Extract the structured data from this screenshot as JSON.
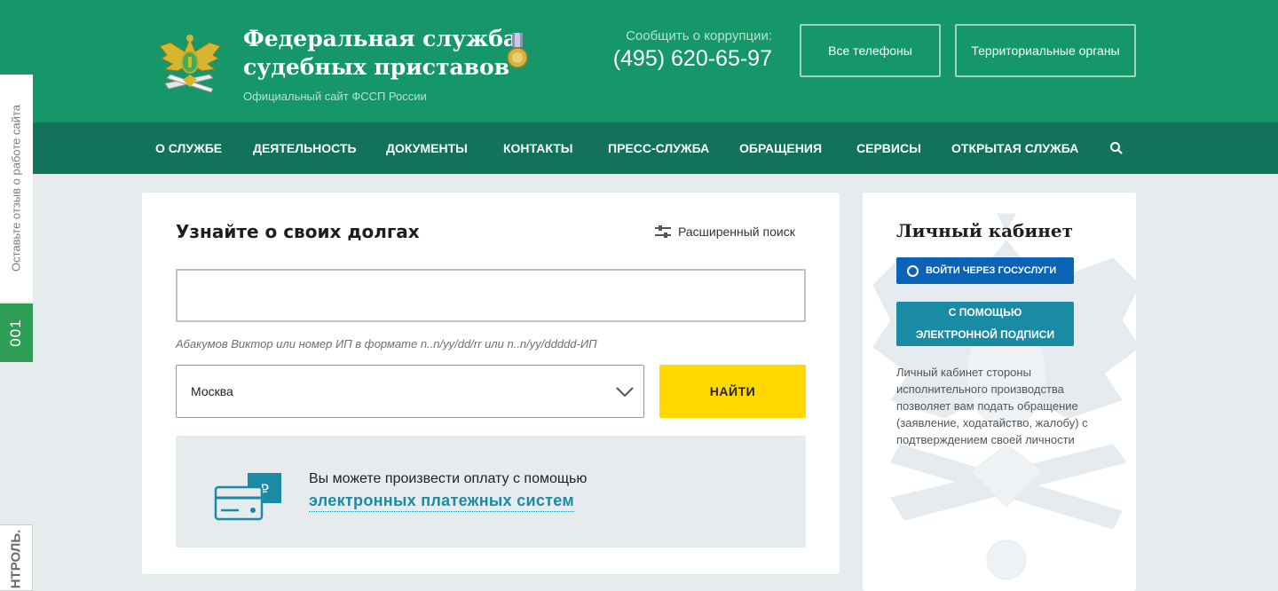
{
  "header": {
    "title_line1": "Федеральная служба",
    "title_line2": "судебных приставов",
    "subtitle": "Официальный сайт ФССП России",
    "corruption_label": "Сообщить о коррупции:",
    "phone": "(495) 620-65-97",
    "phones_button": "Все телефоны",
    "regions_button": "Территориальные органы",
    "logo_icon": "eagle-emblem-icon",
    "medal_icon": "medal-icon"
  },
  "nav": {
    "items": [
      "О СЛУЖБЕ",
      "ДЕЯТЕЛЬНОСТЬ",
      "ДОКУМЕНТЫ",
      "КОНТАКТЫ",
      "ПРЕСС-СЛУЖБА",
      "ОБРАЩЕНИЯ",
      "СЕРВИСЫ",
      "ОТКРЫТАЯ СЛУЖБА"
    ],
    "search_icon": "search-icon"
  },
  "side_tabs": {
    "feedback": "Оставьте отзыв о работе сайта",
    "badge": "001",
    "control": "НТРОЛЬ."
  },
  "debt_search": {
    "title": "Узнайте о своих долгах",
    "advanced_search": "Расширенный поиск",
    "input_value": "",
    "hint": "Абакумов Виктор или номер ИП в формате n..n/yy/dd/rr или n..n/yy/ddddd-ИП",
    "region_value": "Москва",
    "find_button": "НАЙТИ",
    "payment_text": "Вы можете произвести оплату с помощью",
    "payment_link": "электронных платежных систем",
    "payment_icon": "card-ruble-icon"
  },
  "cabinet": {
    "title": "Личный кабинет",
    "gosuslugi_button": "ВОЙТИ ЧЕРЕЗ ГОСУСЛУГИ",
    "sign_button_line1": "С ПОМОЩЬЮ",
    "sign_button_line2": "ЭЛЕКТРОННОЙ ПОДПИСИ",
    "description": "Личный кабинет стороны исполнительного производства позволяет вам подать обращение (заявление, ходатайство, жалобу) с подтверждением своей личности"
  },
  "colors": {
    "header_green": "#15976a",
    "nav_green": "#12735a",
    "accent_yellow": "#ffd800",
    "link_teal": "#1a8ba5",
    "gosuslugi_blue": "#0b63b6"
  }
}
